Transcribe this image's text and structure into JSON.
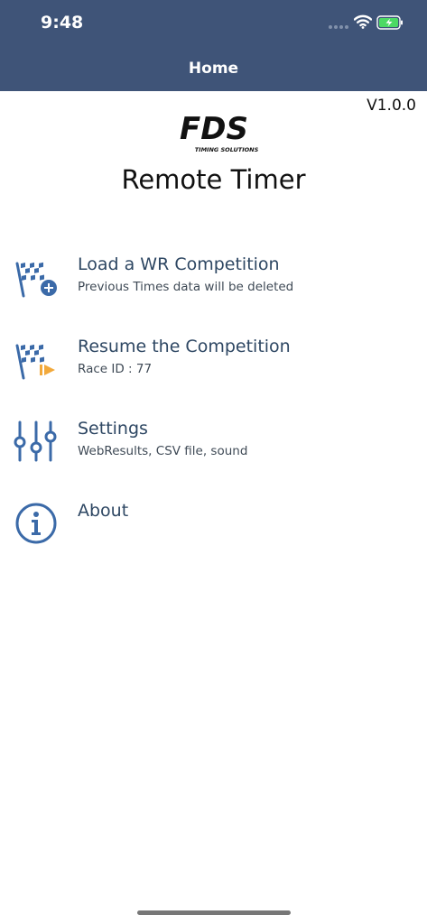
{
  "status_bar": {
    "time": "9:48",
    "icons": [
      "signal-icon",
      "wifi-icon",
      "battery-charging-icon"
    ]
  },
  "nav": {
    "title": "Home"
  },
  "version": "V1.0.0",
  "logo": {
    "main_text": "FDS",
    "sub_text": "TIMING SOLUTIONS"
  },
  "app_title": "Remote Timer",
  "menu": [
    {
      "title": "Load a WR Competition",
      "subtitle": "Previous Times data will be deleted",
      "icon": "checkered-flag-add-icon"
    },
    {
      "title": "Resume the Competition",
      "subtitle": "Race ID : 77",
      "icon": "checkered-flag-resume-icon"
    },
    {
      "title": "Settings",
      "subtitle": "WebResults, CSV file, sound",
      "icon": "sliders-icon"
    },
    {
      "title": "About",
      "subtitle": "",
      "icon": "info-icon"
    }
  ],
  "colors": {
    "header_bg": "#3f5478",
    "icon_blue": "#3b6aa8",
    "resume_accent": "#f2a93b",
    "battery_green": "#4cd964"
  }
}
